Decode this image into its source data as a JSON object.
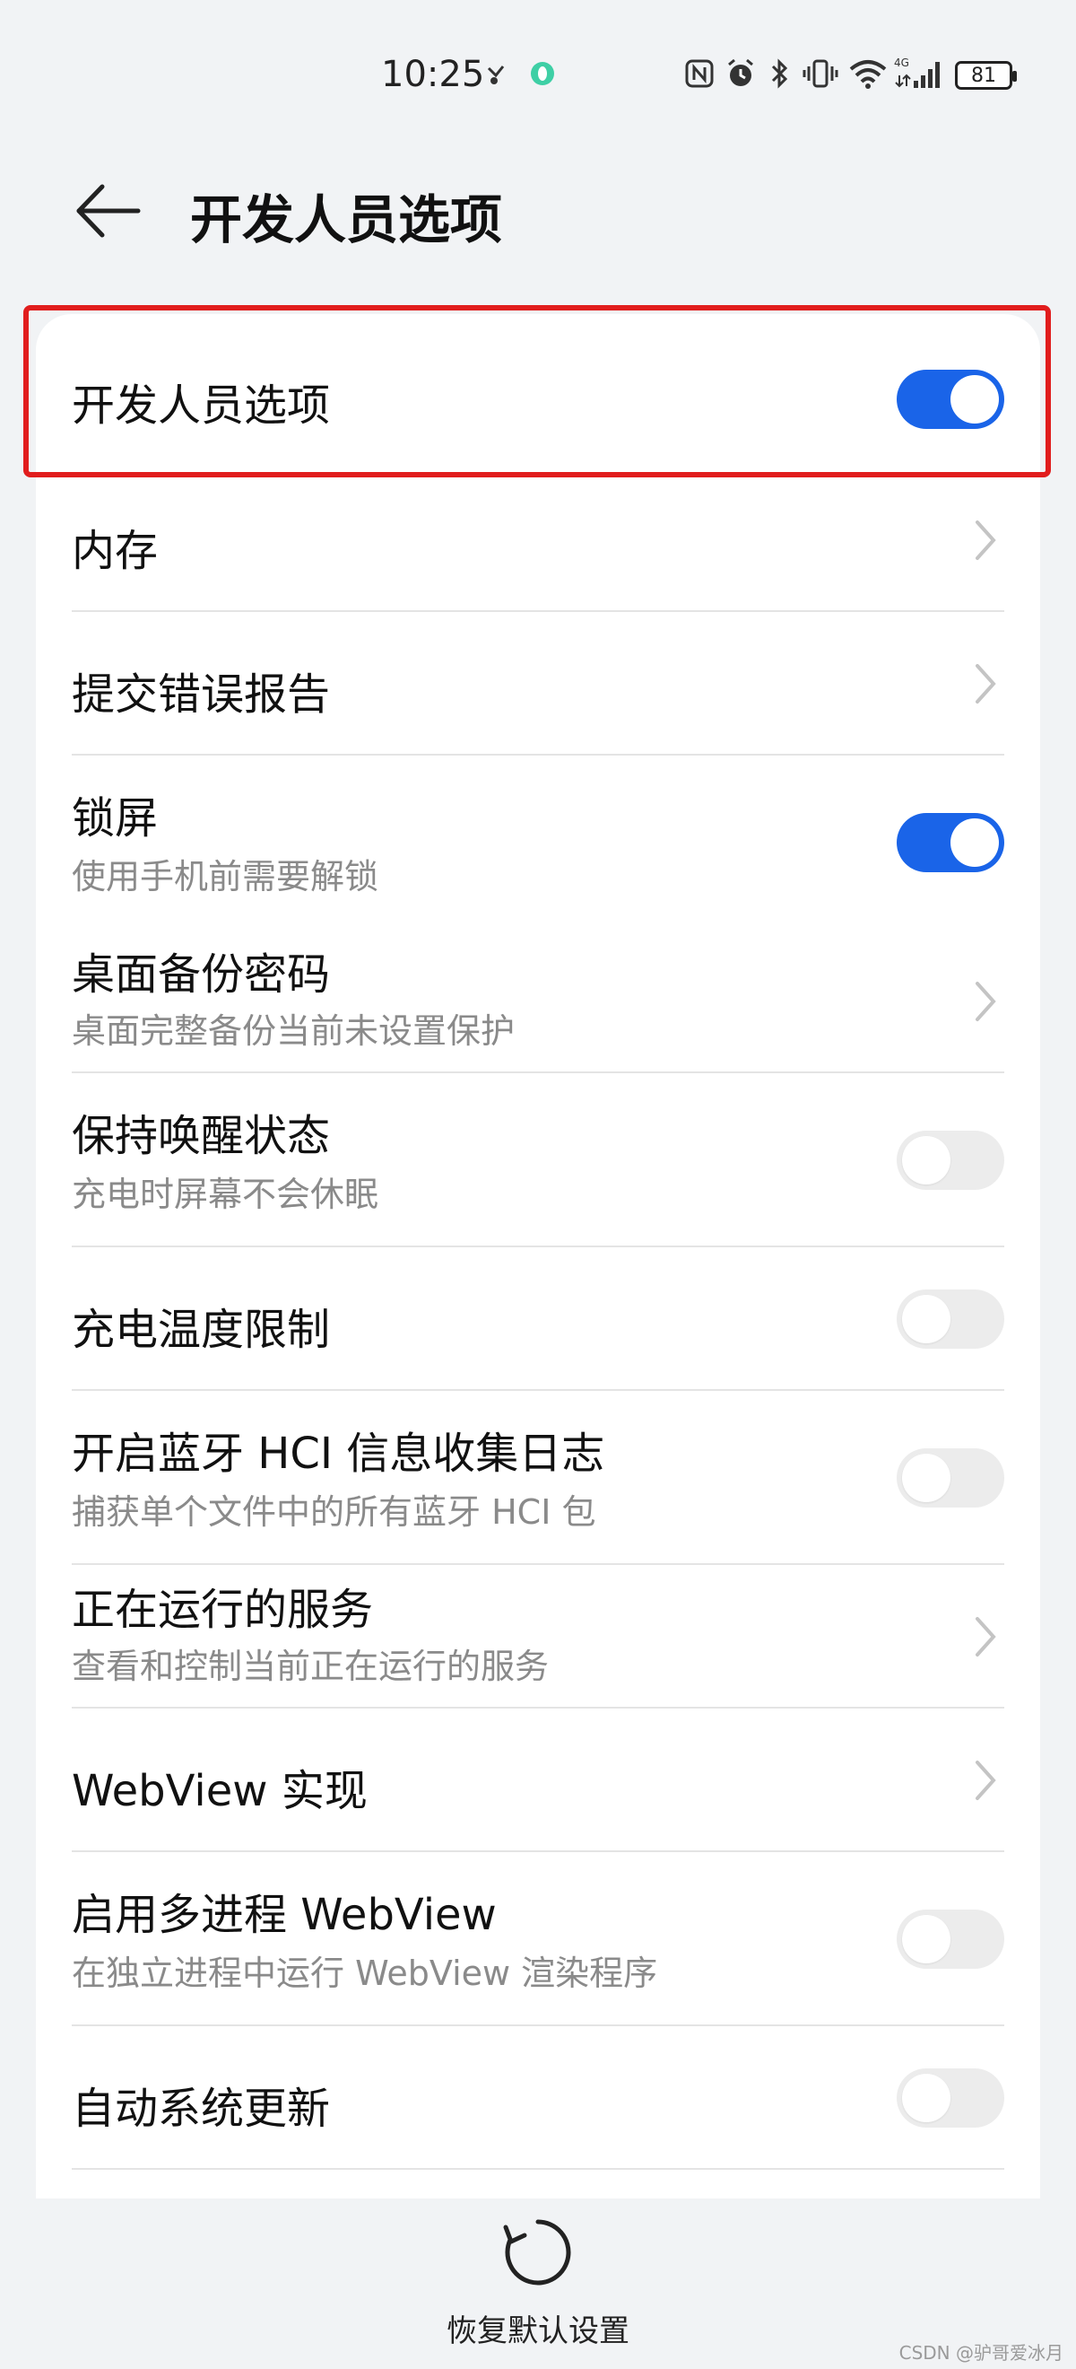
{
  "status_bar": {
    "time": "10:25",
    "battery": "81",
    "network_type": "4G"
  },
  "header": {
    "title": "开发人员选项"
  },
  "settings": [
    {
      "label": "开发人员选项",
      "subtitle": "",
      "control": "toggle",
      "state": "on"
    },
    {
      "label": "内存",
      "subtitle": "",
      "control": "chevron"
    },
    {
      "label": "提交错误报告",
      "subtitle": "",
      "control": "chevron"
    },
    {
      "label": "锁屏",
      "subtitle": "使用手机前需要解锁",
      "control": "toggle",
      "state": "on"
    },
    {
      "label": "桌面备份密码",
      "subtitle": "桌面完整备份当前未设置保护",
      "control": "chevron"
    },
    {
      "label": "保持唤醒状态",
      "subtitle": "充电时屏幕不会休眠",
      "control": "toggle",
      "state": "off"
    },
    {
      "label": "充电温度限制",
      "subtitle": "",
      "control": "toggle",
      "state": "off"
    },
    {
      "label": "开启蓝牙 HCI 信息收集日志",
      "subtitle": "捕获单个文件中的所有蓝牙 HCI 包",
      "control": "toggle",
      "state": "off"
    },
    {
      "label": "正在运行的服务",
      "subtitle": "查看和控制当前正在运行的服务",
      "control": "chevron"
    },
    {
      "label": "WebView 实现",
      "subtitle": "",
      "control": "chevron"
    },
    {
      "label": "启用多进程 WebView",
      "subtitle": "在独立进程中运行 WebView 渲染程序",
      "control": "toggle",
      "state": "off"
    },
    {
      "label": "自动系统更新",
      "subtitle": "",
      "control": "toggle",
      "state": "off"
    }
  ],
  "footer": {
    "reset_label": "恢复默认设置"
  },
  "watermark": "CSDN @驴哥爱冰月",
  "colors": {
    "accent": "#1a64e8",
    "highlight": "#e11d1d",
    "background": "#f1f3f5"
  }
}
